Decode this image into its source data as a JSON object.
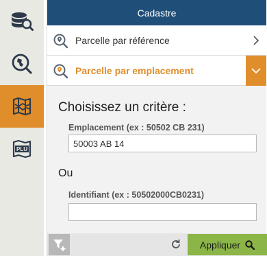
{
  "sidebar": {
    "items": [
      {
        "icon": "database-search-icon"
      },
      {
        "icon": "map-search-icon"
      },
      {
        "icon": "map-folded-icon",
        "active": true
      },
      {
        "icon": "plu-map-icon",
        "badge": "PLU"
      }
    ]
  },
  "panel": {
    "title": "Cadastre",
    "sections": [
      {
        "label": "Parcelle par référence",
        "icon": "search-pin-icon",
        "expanded": false
      },
      {
        "label": "Parcelle par emplacement",
        "icon": "search-pin-icon",
        "expanded": true
      }
    ],
    "form": {
      "heading": "Choisissez un critère :",
      "location_label": "Emplacement (ex : 50502 CB 231)",
      "location_value": "50003 AB 14",
      "separator": "Ou",
      "identifier_label": "Identifiant (ex : 50502000CB0231)",
      "identifier_value": ""
    },
    "footer": {
      "apply_label": "Appliquer"
    }
  },
  "colors": {
    "accent": "#e08e2b",
    "header": "#1f4e79",
    "apply": "#8bb546"
  }
}
